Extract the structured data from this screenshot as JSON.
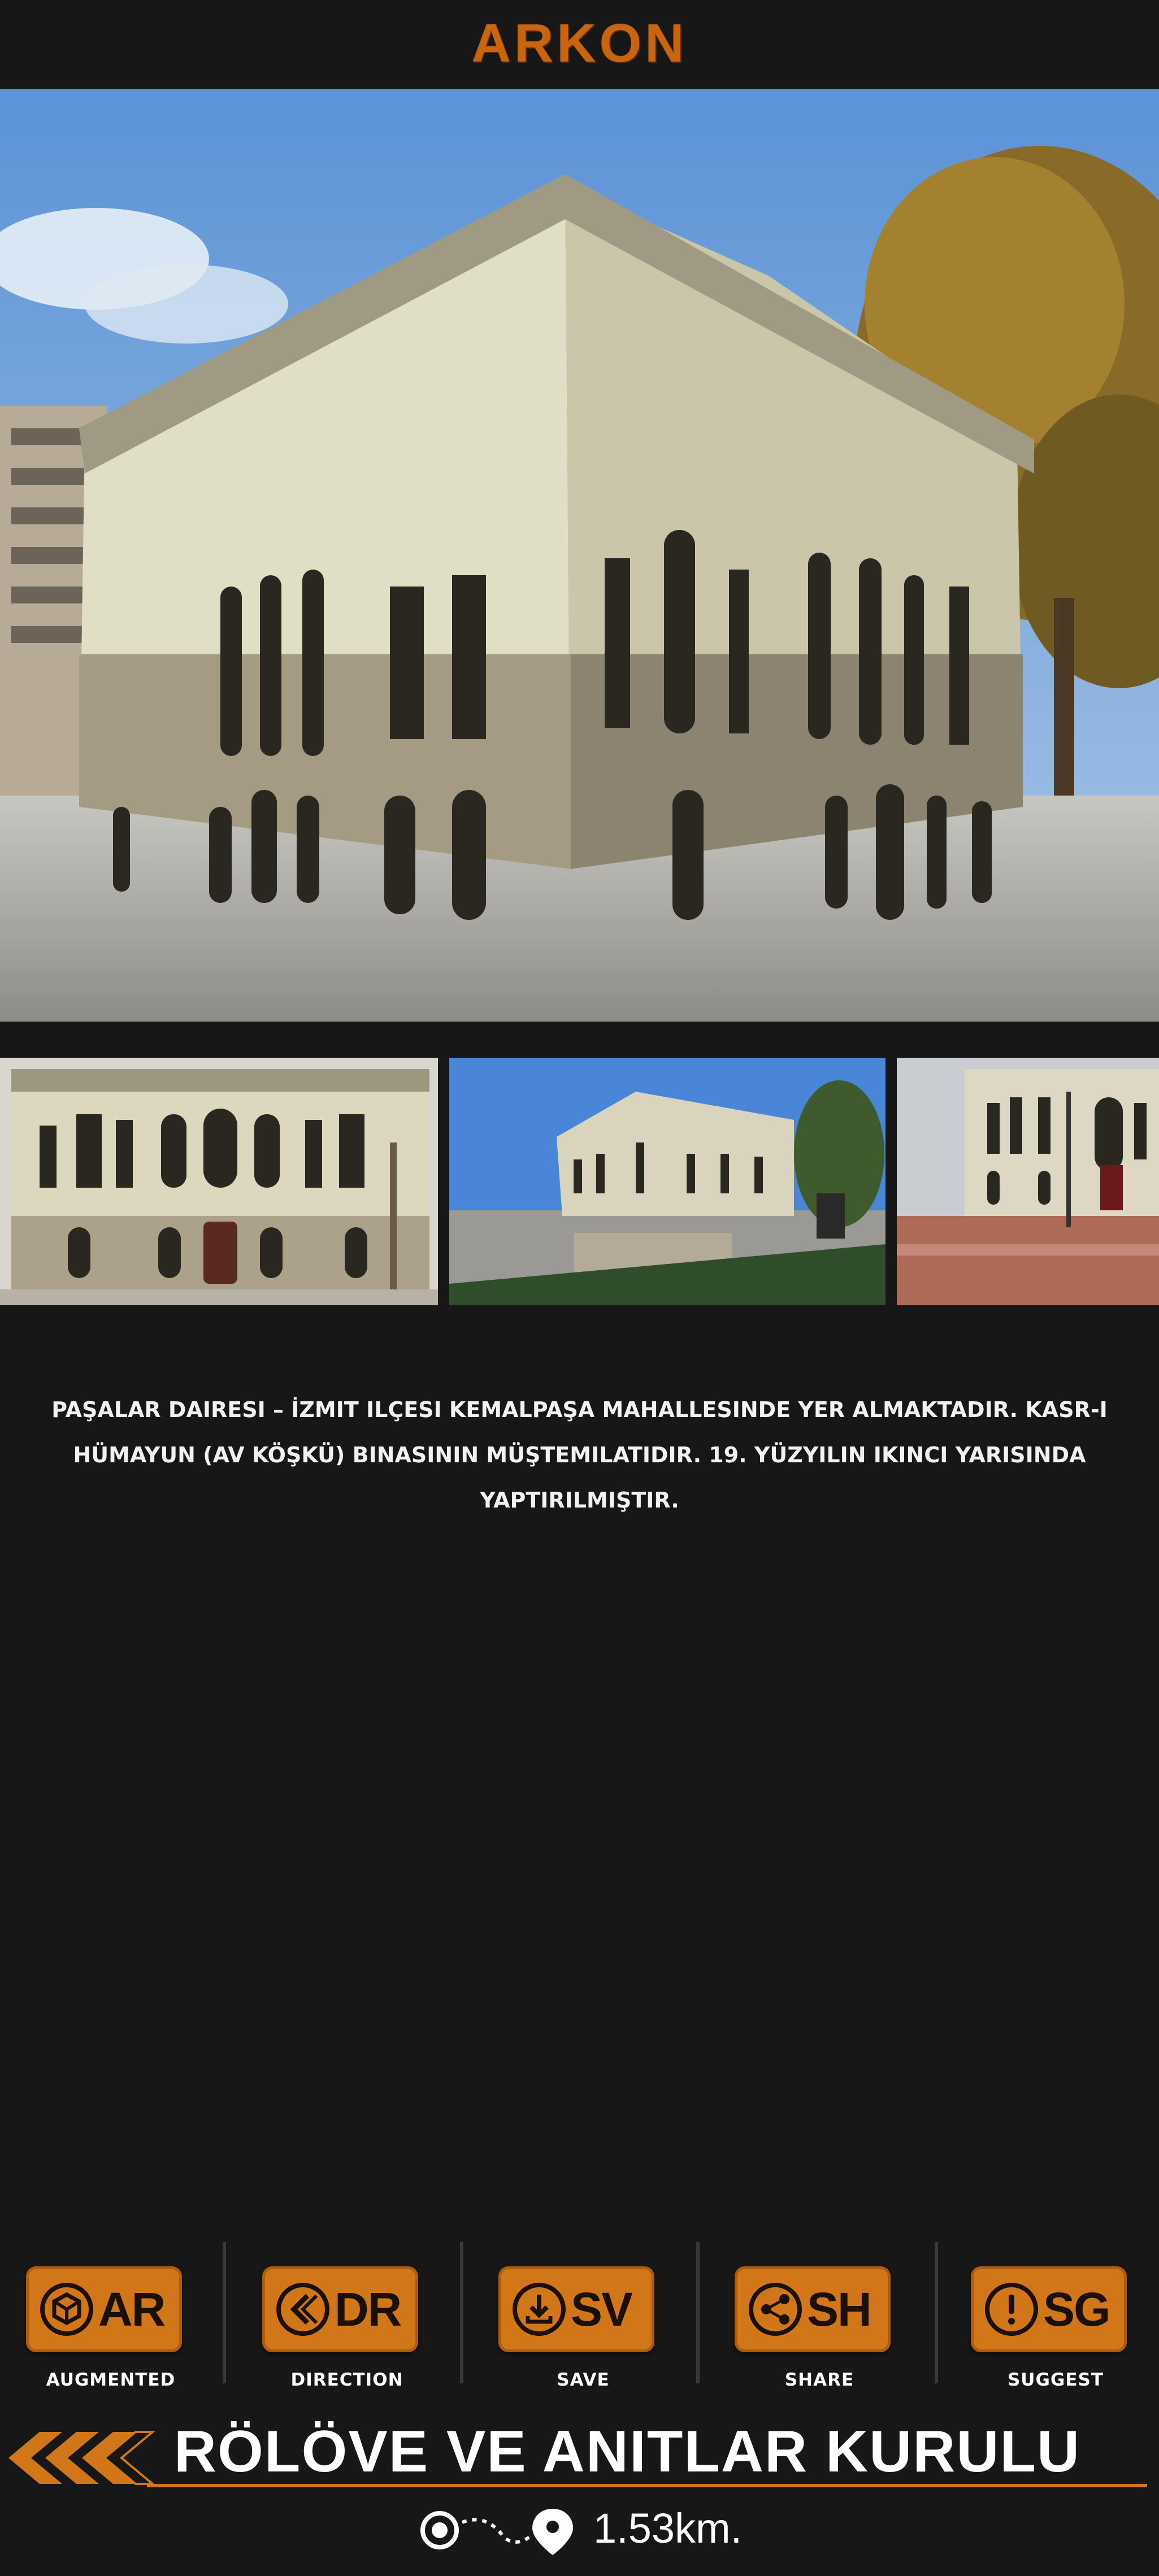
{
  "app": {
    "title": "ARKON"
  },
  "hero": {
    "image_name": "building-main-photo"
  },
  "thumbnails": [
    {
      "name": "thumbnail-front-view"
    },
    {
      "name": "thumbnail-plaza-view"
    },
    {
      "name": "thumbnail-wet-plaza-view"
    }
  ],
  "description": "PAŞALAR DAIRESI – İZMIT ILÇESI KEMALPAŞA MAHALLESINDE YER ALMAKTADIR. KASR-I HÜMAYUN (AV KÖŞKÜ) BINASININ MÜŞTEMILATIDIR. 19. YÜZYILIN IKINCI YARISINDA YAPTIRILMIŞTIR.",
  "actions": [
    {
      "abbr": "AR",
      "label": "AUGMENTED",
      "icon": "cube-in-circle-icon"
    },
    {
      "abbr": "DR",
      "label": "DIRECTION",
      "icon": "chevron-left-circle-icon"
    },
    {
      "abbr": "SV",
      "label": "SAVE",
      "icon": "download-icon"
    },
    {
      "abbr": "SH",
      "label": "SHARE",
      "icon": "share-icon"
    },
    {
      "abbr": "SG",
      "label": "SUGGEST",
      "icon": "exclamation-circle-icon"
    }
  ],
  "footer": {
    "title": "RÖLÖVE VE ANITLAR KURULU",
    "distance": "1.53km.",
    "icons": [
      "back-chevrons-icon",
      "route-origin-icon",
      "location-pin-icon"
    ]
  },
  "colors": {
    "accent": "#d2761a",
    "background": "#171718",
    "text": "#ffffff"
  }
}
